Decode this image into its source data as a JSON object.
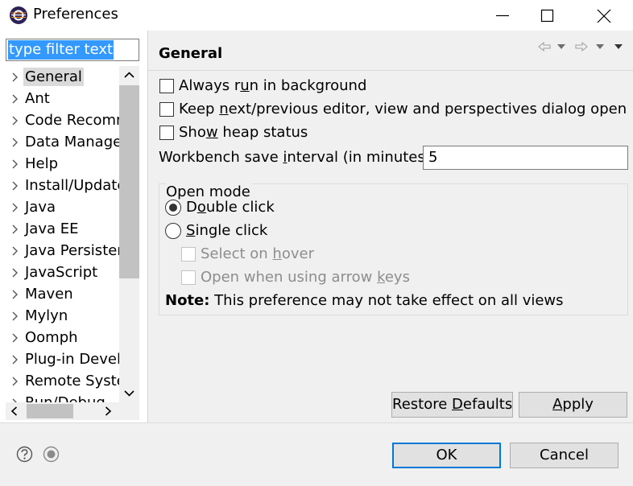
{
  "window": {
    "title": "Preferences",
    "icon": "eclipse-icon",
    "controls": [
      "minimize-icon",
      "maximize-icon",
      "close-icon"
    ]
  },
  "filter": {
    "text": "type filter text"
  },
  "tree": {
    "items": [
      {
        "label": "General",
        "selected": true
      },
      {
        "label": "Ant"
      },
      {
        "label": "Code Recomm"
      },
      {
        "label": "Data Manage"
      },
      {
        "label": "Help"
      },
      {
        "label": "Install/Update"
      },
      {
        "label": "Java"
      },
      {
        "label": "Java EE"
      },
      {
        "label": "Java Persisten"
      },
      {
        "label": "JavaScript"
      },
      {
        "label": "Maven"
      },
      {
        "label": "Mylyn"
      },
      {
        "label": "Oomph"
      },
      {
        "label": "Plug-in Devel"
      },
      {
        "label": "Remote Syste"
      },
      {
        "label": "Run/Debug"
      }
    ]
  },
  "page": {
    "title": "General",
    "nav_icons": [
      "back-arrow-icon",
      "back-dropdown-icon",
      "forward-arrow-icon",
      "forward-dropdown-icon",
      "view-menu-icon"
    ],
    "checkboxes": [
      {
        "pre": "Always r",
        "mnemonic": "u",
        "post": "n in background",
        "checked": false
      },
      {
        "pre": "Keep ",
        "mnemonic": "n",
        "post": "ext/previous editor, view and perspectives dialog open",
        "checked": false
      },
      {
        "pre": "Sho",
        "mnemonic": "w",
        "post": " heap status",
        "checked": false
      }
    ],
    "interval": {
      "pre": "Workbench save ",
      "mnemonic": "i",
      "post": "nterval (in minutes):",
      "value": "5"
    },
    "open_mode": {
      "label": "Open mode",
      "double_click": {
        "pre": "D",
        "mnemonic": "o",
        "post": "uble click",
        "selected": true
      },
      "single_click": {
        "pre": "",
        "mnemonic": "S",
        "post": "ingle click",
        "selected": false
      },
      "select_on_hover": {
        "pre": "Select on ",
        "mnemonic": "h",
        "post": "over",
        "enabled": false
      },
      "open_arrow_keys": {
        "pre": "Open when using arrow ",
        "mnemonic": "k",
        "post": "eys",
        "enabled": false
      },
      "note_bold": "Note:",
      "note_text": " This preference may not take effect on all views"
    },
    "restore_defaults": {
      "pre": "Restore ",
      "mnemonic": "D",
      "post": "efaults"
    },
    "apply": {
      "pre": "",
      "mnemonic": "A",
      "post": "pply"
    }
  },
  "footer": {
    "help_icon": "help-icon",
    "record_icon": "record-icon",
    "ok": "OK",
    "cancel": "Cancel"
  },
  "colors": {
    "selection": "#3399ff",
    "default_button_border": "#0078d7",
    "panel_bg": "#f0f0f0"
  }
}
